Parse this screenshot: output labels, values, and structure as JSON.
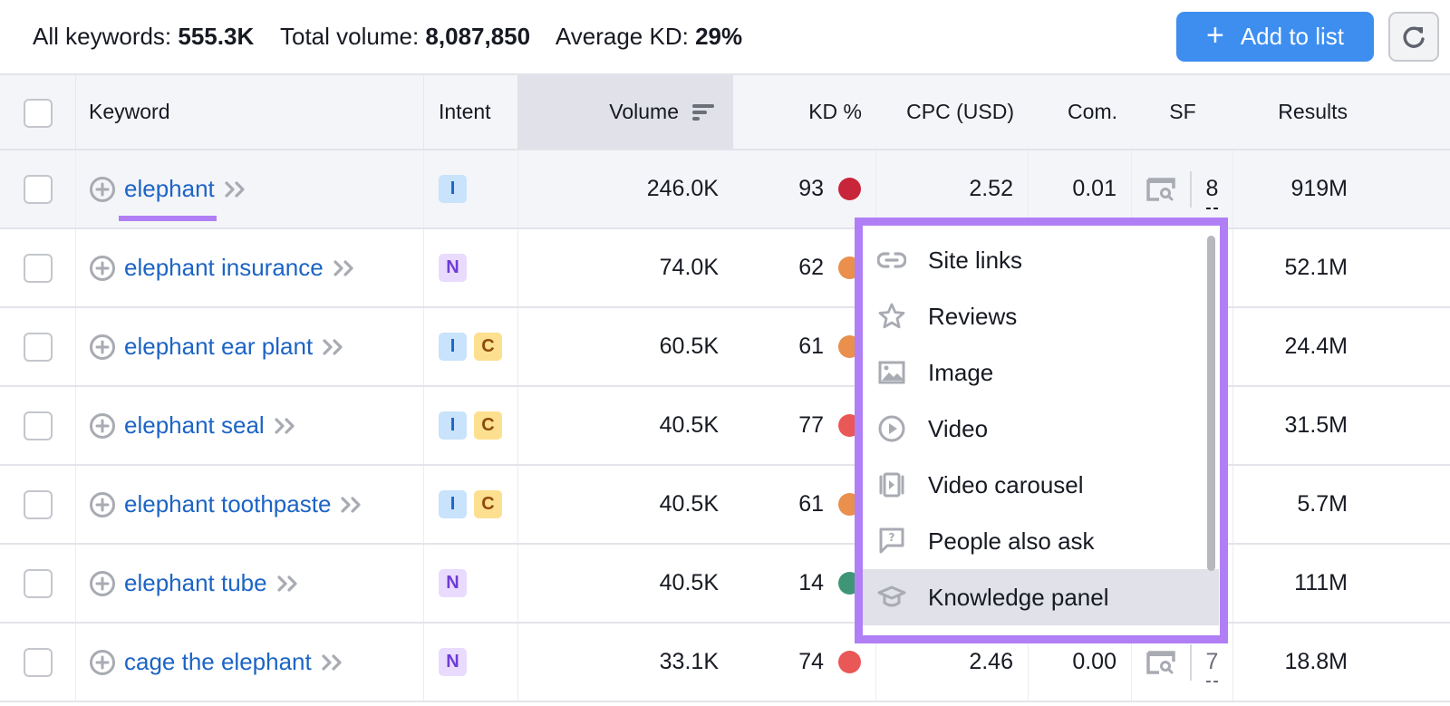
{
  "summary": {
    "all_keywords_label": "All keywords:",
    "all_keywords_value": "555.3K",
    "total_volume_label": "Total volume:",
    "total_volume_value": "8,087,850",
    "average_kd_label": "Average KD:",
    "average_kd_value": "29%"
  },
  "toolbar": {
    "add_to_list_label": "Add to list",
    "add_icon": "plus-icon",
    "refresh_icon": "refresh-icon"
  },
  "colors": {
    "accent": "#3e8ef0",
    "highlight": "#b07ff5",
    "link": "#1c64c5",
    "kd_very_hard": "#c8243a",
    "kd_hard": "#e95757",
    "kd_difficult": "#ea8f4c",
    "kd_easy": "#3f9677"
  },
  "table": {
    "columns": {
      "keyword": "Keyword",
      "intent": "Intent",
      "volume": "Volume",
      "kd": "KD %",
      "cpc": "CPC (USD)",
      "com": "Com.",
      "sf": "SF",
      "results": "Results"
    },
    "sorted_by": "volume",
    "rows": [
      {
        "keyword": "elephant",
        "intents": [
          "I"
        ],
        "volume": "246.0K",
        "kd": "93",
        "kd_color": "#c8243a",
        "cpc": "2.52",
        "com": "0.01",
        "sf": "8",
        "results": "919M"
      },
      {
        "keyword": "elephant insurance",
        "intents": [
          "N"
        ],
        "volume": "74.0K",
        "kd": "62",
        "kd_color": "#ea8f4c",
        "cpc": "",
        "com": "",
        "sf": "",
        "results": "52.1M"
      },
      {
        "keyword": "elephant ear plant",
        "intents": [
          "I",
          "C"
        ],
        "volume": "60.5K",
        "kd": "61",
        "kd_color": "#ea8f4c",
        "cpc": "",
        "com": "",
        "sf": "",
        "results": "24.4M"
      },
      {
        "keyword": "elephant seal",
        "intents": [
          "I",
          "C"
        ],
        "volume": "40.5K",
        "kd": "77",
        "kd_color": "#e95757",
        "cpc": "",
        "com": "",
        "sf": "",
        "results": "31.5M"
      },
      {
        "keyword": "elephant toothpaste",
        "intents": [
          "I",
          "C"
        ],
        "volume": "40.5K",
        "kd": "61",
        "kd_color": "#ea8f4c",
        "cpc": "",
        "com": "",
        "sf": "",
        "results": "5.7M"
      },
      {
        "keyword": "elephant tube",
        "intents": [
          "N"
        ],
        "volume": "40.5K",
        "kd": "14",
        "kd_color": "#3f9677",
        "cpc": "",
        "com": "",
        "sf": "",
        "results": "111M"
      },
      {
        "keyword": "cage the elephant",
        "intents": [
          "N"
        ],
        "volume": "33.1K",
        "kd": "74",
        "kd_color": "#e95757",
        "cpc": "2.46",
        "com": "0.00",
        "sf": "7",
        "results": "18.8M"
      }
    ]
  },
  "sf_popup": {
    "items": [
      {
        "label": "Site links",
        "icon": "link-icon"
      },
      {
        "label": "Reviews",
        "icon": "star-icon"
      },
      {
        "label": "Image",
        "icon": "image-icon"
      },
      {
        "label": "Video",
        "icon": "play-circle-icon"
      },
      {
        "label": "Video carousel",
        "icon": "video-carousel-icon"
      },
      {
        "label": "People also ask",
        "icon": "question-bubble-icon"
      },
      {
        "label": "Knowledge panel",
        "icon": "graduation-cap-icon",
        "active": true
      }
    ]
  }
}
